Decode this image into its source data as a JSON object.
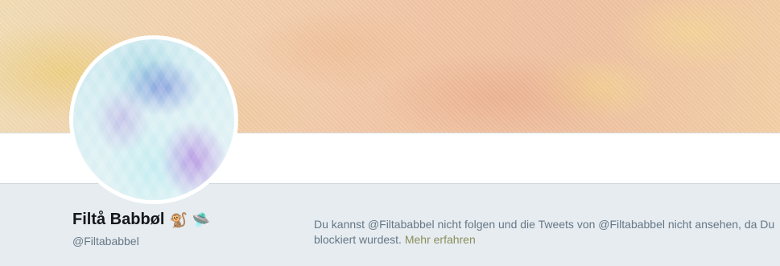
{
  "profile": {
    "name": "Filtå Babbøl",
    "emojis": [
      "🐒",
      "🛸"
    ],
    "emoji_names": [
      "monkey-emoji",
      "ufo-emoji"
    ],
    "handle": "@Filtababbel"
  },
  "notice": {
    "text": "Du kannst @Filtababbel nicht folgen und die Tweets von @Filtababbel nicht ansehen, da Du blockiert wurdest.",
    "link_label": "Mehr erfahren"
  },
  "colors": {
    "page_background": "#e6ecf0",
    "name_text": "#14171a",
    "muted_text": "#657786",
    "link": "#8a8f5c"
  }
}
